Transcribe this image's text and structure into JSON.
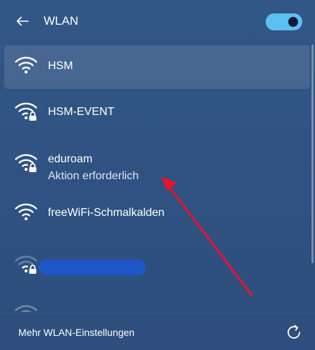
{
  "header": {
    "back_icon": "arrow-left-icon",
    "title": "WLAN",
    "toggle_state": "on",
    "toggle_color": "#5cc0f4"
  },
  "networks": [
    {
      "name": "HSM",
      "secured": false,
      "selected": true,
      "status": ""
    },
    {
      "name": "HSM-EVENT",
      "secured": true,
      "selected": false,
      "status": ""
    },
    {
      "name": "eduroam",
      "secured": true,
      "selected": false,
      "status": "Aktion erforderlich"
    },
    {
      "name": "freeWiFi-Schmalkalden",
      "secured": false,
      "selected": false,
      "status": ""
    },
    {
      "name": "",
      "secured": true,
      "selected": false,
      "status": "",
      "redacted": true
    }
  ],
  "footer": {
    "link_label": "Mehr WLAN-Einstellungen",
    "refresh_icon": "refresh-icon"
  },
  "annotation": {
    "arrow_color": "#e8142c",
    "points_to": "eduroam status"
  }
}
